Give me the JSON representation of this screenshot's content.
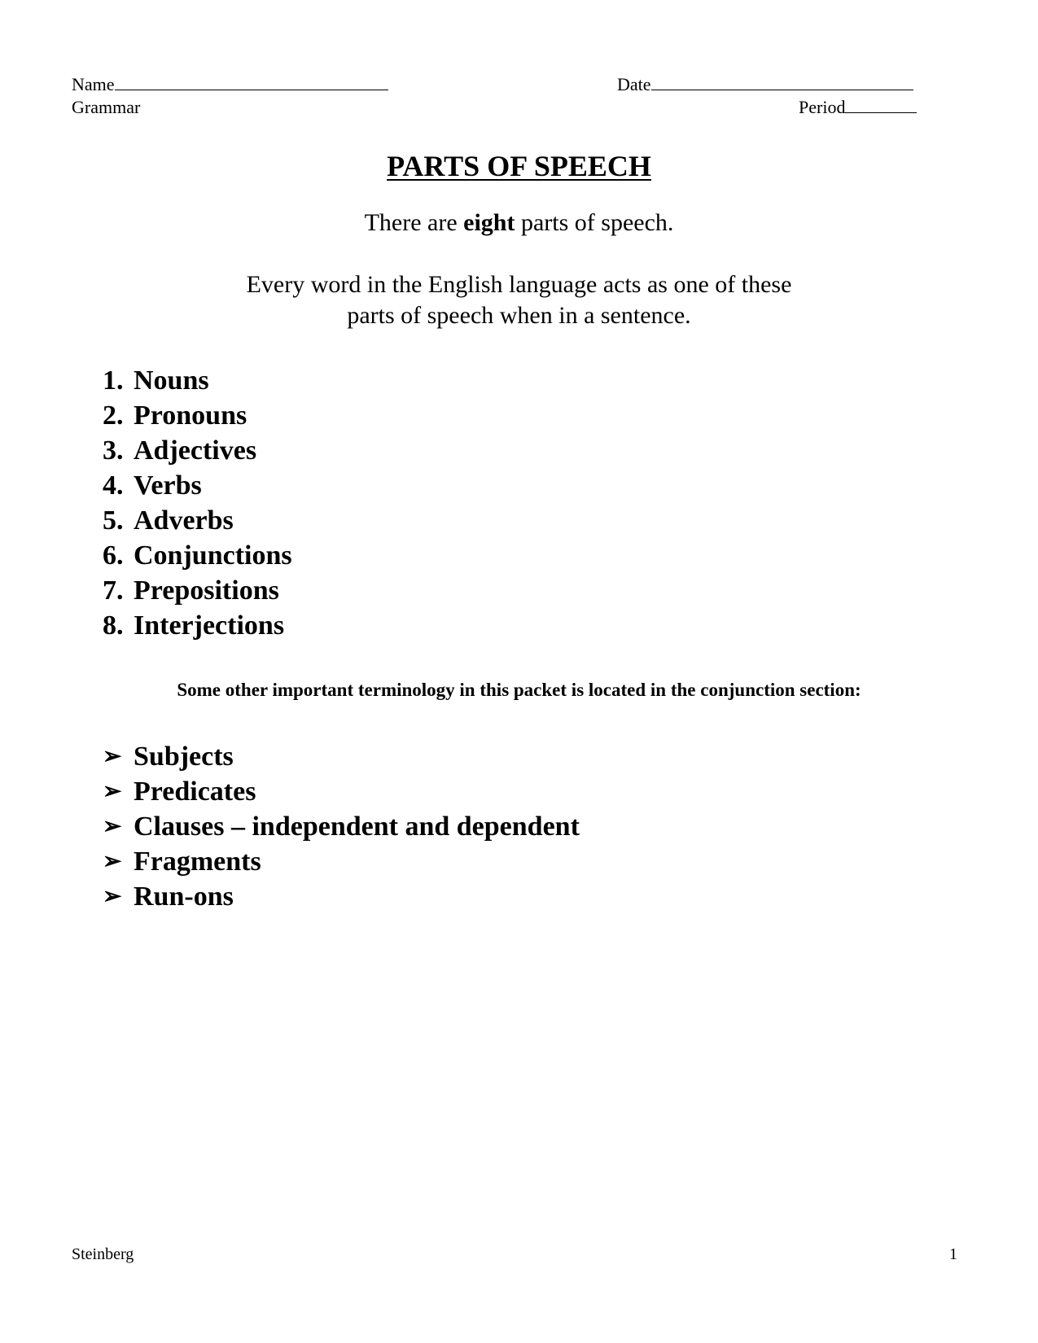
{
  "header": {
    "name_label": "Name",
    "date_label": "Date",
    "subject_label": "Grammar",
    "period_label": "Period"
  },
  "title": "PARTS OF SPEECH",
  "intro": {
    "before": "There are ",
    "emphasis": "eight",
    "after": " parts of speech."
  },
  "description": {
    "line1": "Every word in the English language acts as one of these",
    "line2": "parts of speech when in a sentence."
  },
  "parts_of_speech": [
    {
      "num": "1.",
      "label": "Nouns"
    },
    {
      "num": "2.",
      "label": "Pronouns"
    },
    {
      "num": "3.",
      "label": "Adjectives"
    },
    {
      "num": "4.",
      "label": "Verbs"
    },
    {
      "num": "5.",
      "label": "Adverbs"
    },
    {
      "num": "6.",
      "label": "Conjunctions"
    },
    {
      "num": "7.",
      "label": "Prepositions"
    },
    {
      "num": "8.",
      "label": "Interjections"
    }
  ],
  "note": "Some other important terminology in this packet is located in the conjunction section:",
  "terminology": [
    {
      "icon": "arrowhead-bullet-icon",
      "glyph": "➢",
      "label": "Subjects"
    },
    {
      "icon": "arrowhead-bullet-icon",
      "glyph": "➢",
      "label": "Predicates"
    },
    {
      "icon": "arrowhead-bullet-icon",
      "glyph": "➢",
      "label": "Clauses – independent and dependent"
    },
    {
      "icon": "arrowhead-bullet-icon",
      "glyph": "➢",
      "label": "Fragments"
    },
    {
      "icon": "arrowhead-bullet-icon",
      "glyph": "➢",
      "label": "Run-ons"
    }
  ],
  "footer": {
    "author": "Steinberg",
    "page_number": "1"
  }
}
